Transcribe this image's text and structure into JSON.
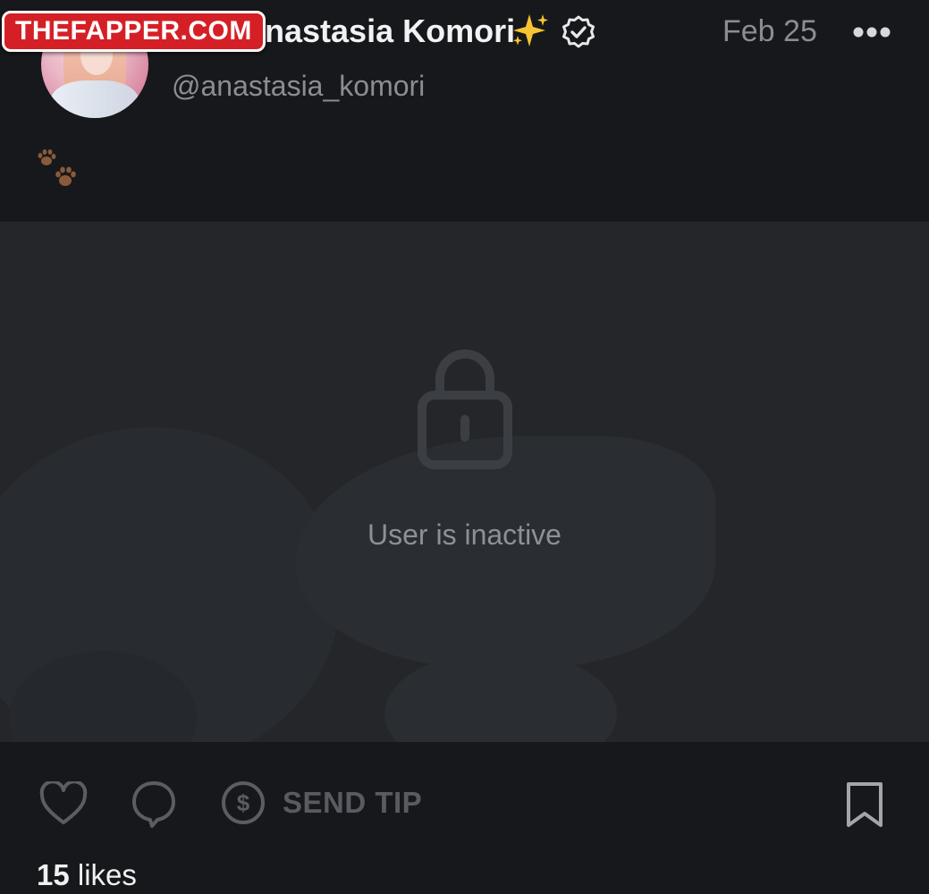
{
  "watermark": {
    "text": "THEFAPPER.COM"
  },
  "post": {
    "author": {
      "display_name": "Anastasia Komori",
      "username": "@anastasia_komori",
      "avatar_icon": "profile-photo",
      "badges": [
        "sparkles-emoji",
        "verified-badge-icon"
      ]
    },
    "date": "Feb 25",
    "menu_icon": "more-options-icon",
    "text_icon": "paw-prints-emoji",
    "media": {
      "status_icon": "lock-icon",
      "status_text": "User is inactive"
    }
  },
  "actions": {
    "like_icon": "heart-icon",
    "comment_icon": "comment-bubble-icon",
    "tip_icon": "dollar-circle-icon",
    "tip_label": "SEND TIP",
    "bookmark_icon": "bookmark-icon"
  },
  "likes": {
    "count": "15",
    "label": "likes"
  },
  "colors": {
    "background": "#17181b",
    "media_background": "#24262a",
    "muted_text": "#8b8d94",
    "watermark_red": "#d51f26",
    "sparkle_yellow": "#f7c531"
  }
}
